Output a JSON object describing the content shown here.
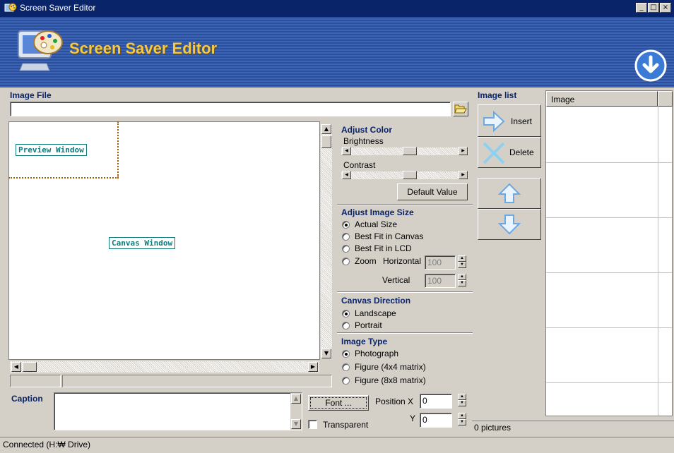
{
  "window": {
    "title": "Screen Saver Editor",
    "min": "_",
    "max": "□",
    "close": "×"
  },
  "banner": {
    "title": "Screen Saver Editor"
  },
  "image_file": {
    "label": "Image File",
    "value": ""
  },
  "canvas": {
    "preview_label": "Preview Window",
    "canvas_label": "Canvas Window"
  },
  "adjust_color": {
    "title": "Adjust Color",
    "brightness_label": "Brightness",
    "brightness_level": 0.55,
    "contrast_label": "Contrast",
    "contrast_level": 0.55,
    "default_button": "Default Value"
  },
  "adjust_size": {
    "title": "Adjust Image Size",
    "options": [
      "Actual Size",
      "Best Fit in Canvas",
      "Best Fit in LCD"
    ],
    "selected": "Actual Size",
    "zoom_label": "Zoom",
    "horizontal_label": "Horizontal",
    "horizontal_value": "100",
    "vertical_label": "Vertical",
    "vertical_value": "100"
  },
  "canvas_direction": {
    "title": "Canvas Direction",
    "options": [
      "Landscape",
      "Portrait"
    ],
    "selected": "Landscape"
  },
  "image_type": {
    "title": "Image Type",
    "options": [
      "Photograph",
      "Figure (4x4 matrix)",
      "Figure (8x8 matrix)"
    ],
    "selected": "Photograph"
  },
  "caption": {
    "label": "Caption",
    "value": "",
    "font_button": "Font ...",
    "position_x_label": "Position X",
    "position_x_value": "0",
    "y_label": "Y",
    "y_value": "0",
    "transparent_label": "Transparent",
    "transparent_checked": false
  },
  "image_list": {
    "label": "Image list",
    "insert_button": "Insert",
    "delete_button": "Delete",
    "column_header": "Image",
    "count_text": "0 pictures"
  },
  "status_bar": {
    "text": "Connected (H:₩ Drive)"
  },
  "colors": {
    "titlebar": "#0a246a",
    "banner": "#3c64b6",
    "banner_text": "#f2c94a",
    "section_title": "#0a246a"
  },
  "icons": [
    "screensaver-app-icon",
    "folder-open-icon",
    "insert-arrow-icon",
    "delete-x-icon",
    "move-up-icon",
    "move-down-icon",
    "download-circle-icon"
  ]
}
